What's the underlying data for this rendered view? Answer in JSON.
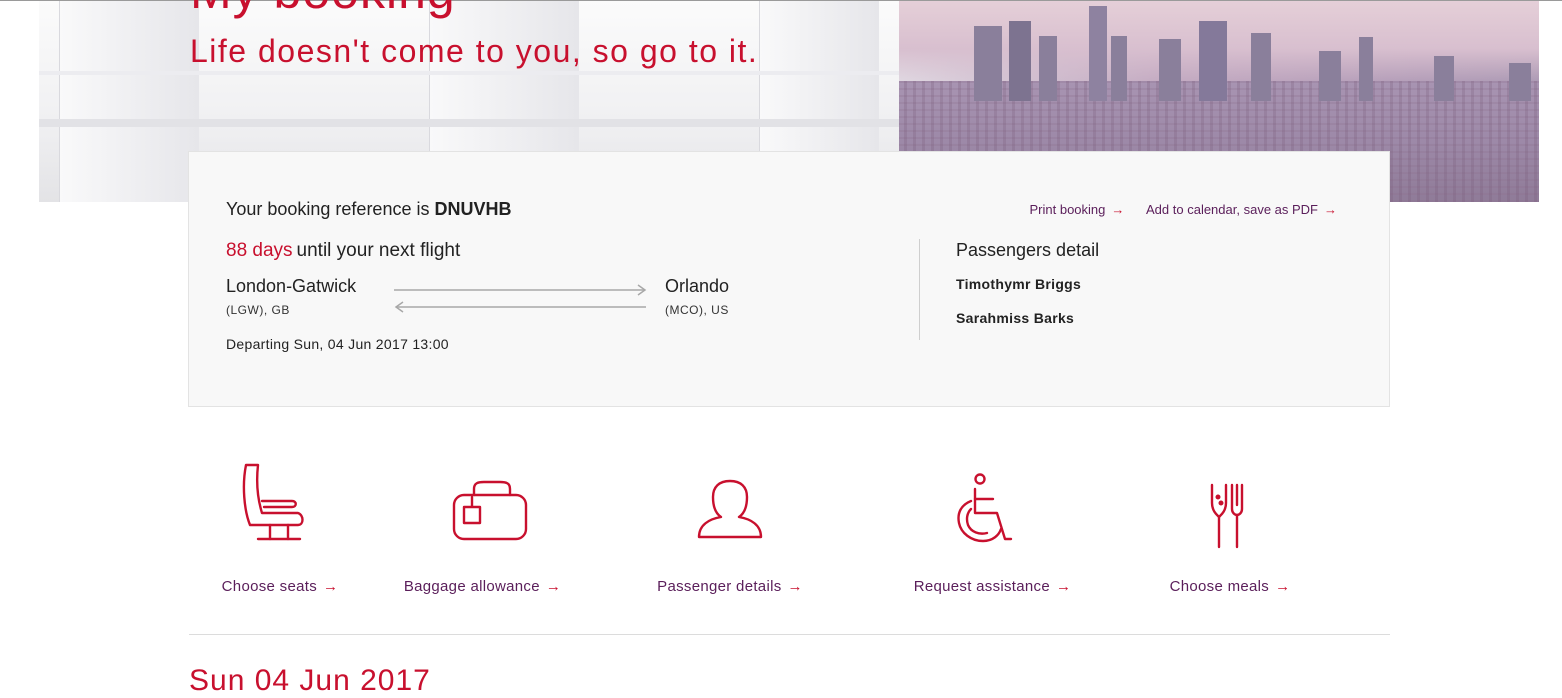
{
  "hero": {
    "title": "My booking",
    "subtitle": "Life doesn't come to you, so go to it."
  },
  "booking": {
    "reference_prefix": "Your booking reference is",
    "reference_code": "DNUVHB",
    "links": {
      "print": "Print booking",
      "calendar": "Add to calendar, save as PDF"
    },
    "days_count": "88 days",
    "days_suffix": "until your next flight",
    "origin": {
      "city": "London-Gatwick",
      "code": "(LGW), GB"
    },
    "destination": {
      "city": "Orlando",
      "code": "(MCO), US"
    },
    "departing": "Departing Sun, 04 Jun 2017 13:00"
  },
  "passengers": {
    "title": "Passengers detail",
    "names": [
      "Timothymr Briggs",
      "Sarahmiss Barks"
    ]
  },
  "actions": [
    {
      "label": "Choose seats",
      "icon": "seat-icon"
    },
    {
      "label": "Baggage allowance",
      "icon": "baggage-icon"
    },
    {
      "label": "Passenger details",
      "icon": "person-icon"
    },
    {
      "label": "Request assistance",
      "icon": "wheelchair-icon"
    },
    {
      "label": "Choose meals",
      "icon": "meal-icon"
    }
  ],
  "itinerary": {
    "date_heading": "Sun 04 Jun 2017"
  },
  "colors": {
    "accent": "#c8102e",
    "link": "#5a1e5a"
  }
}
